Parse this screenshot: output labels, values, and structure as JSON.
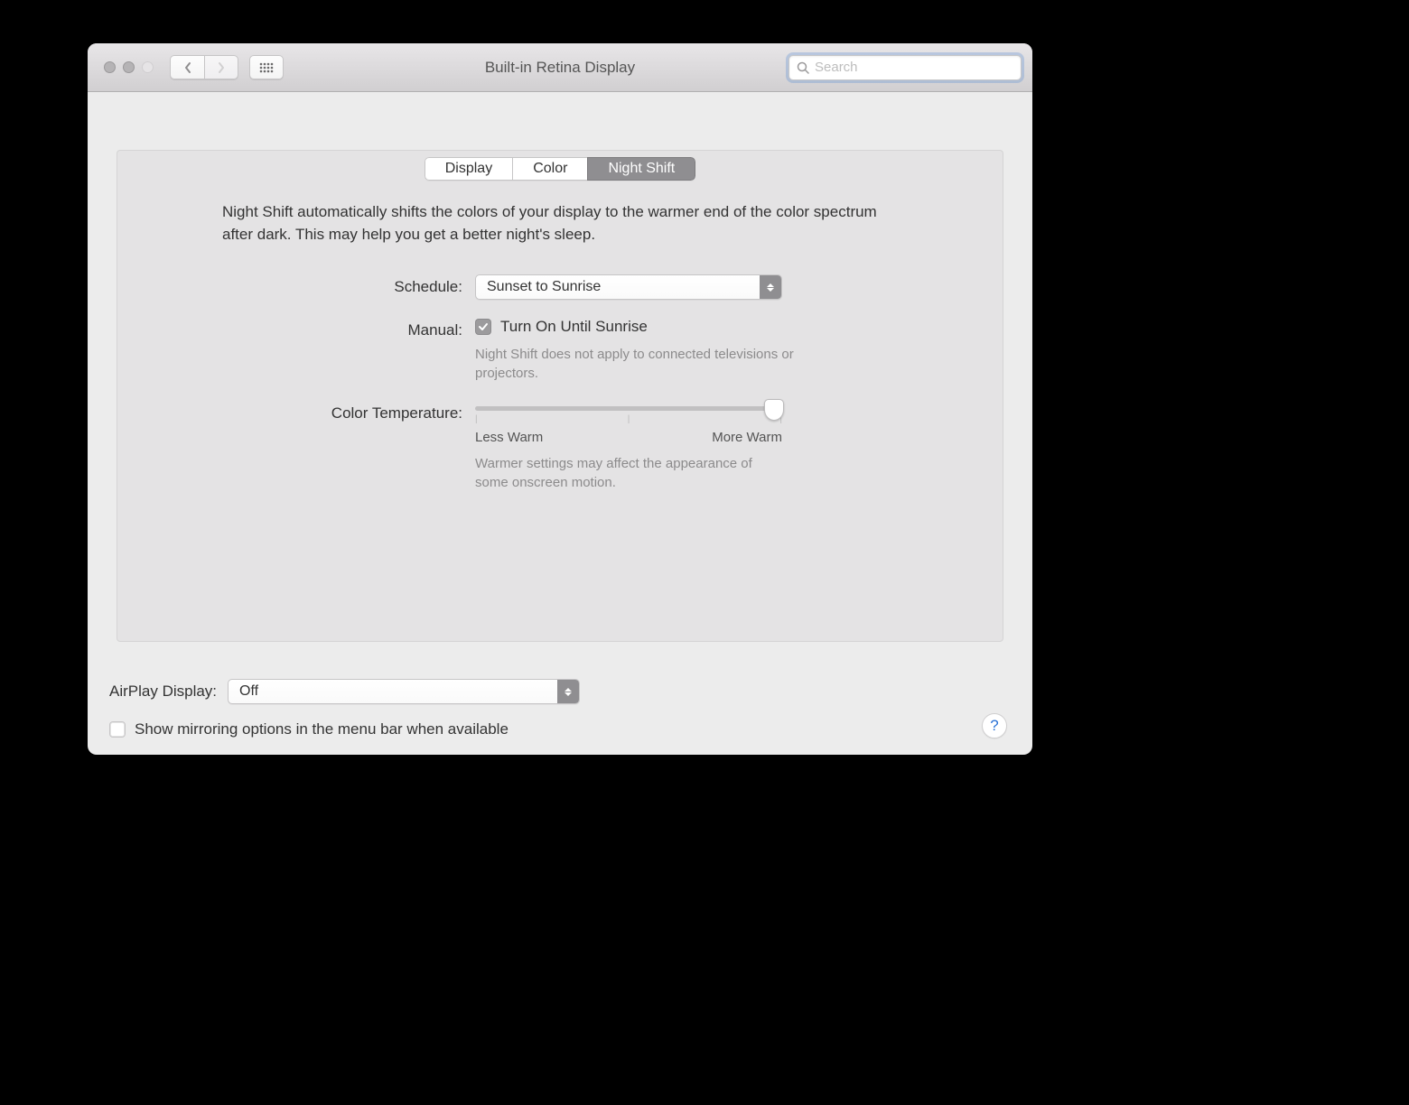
{
  "titlebar": {
    "title": "Built-in Retina Display",
    "search_placeholder": "Search"
  },
  "tabs": {
    "display": "Display",
    "color": "Color",
    "night_shift": "Night Shift"
  },
  "intro": "Night Shift automatically shifts the colors of your display to the warmer end of the color spectrum after dark. This may help you get a better night's sleep.",
  "schedule": {
    "label": "Schedule:",
    "value": "Sunset to Sunrise"
  },
  "manual": {
    "label": "Manual:",
    "checkbox_label": "Turn On Until Sunrise",
    "note": "Night Shift does not apply to connected televisions or projectors."
  },
  "color_temp": {
    "label": "Color Temperature:",
    "less": "Less Warm",
    "more": "More Warm",
    "note": "Warmer settings may affect the appearance of some onscreen motion."
  },
  "airplay": {
    "label": "AirPlay Display:",
    "value": "Off"
  },
  "mirroring": {
    "label": "Show mirroring options in the menu bar when available"
  },
  "help": "?"
}
